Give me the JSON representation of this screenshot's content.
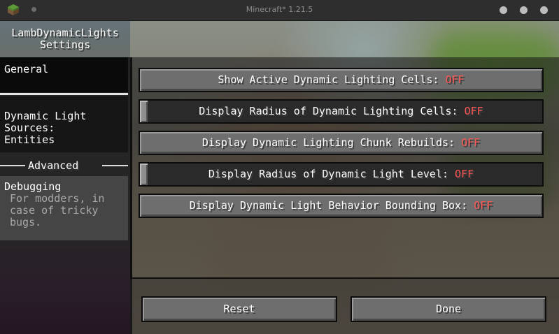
{
  "window": {
    "title": "Minecraft* 1.21.5"
  },
  "sidebar": {
    "title_line1": "LambDynamicLights",
    "title_line2": "Settings",
    "items": [
      {
        "label": "General"
      },
      {
        "label_lines": [
          "Dynamic Light",
          "Sources:",
          "Entities"
        ]
      }
    ],
    "advanced_header": "Advanced",
    "debugging": {
      "label": "Debugging",
      "description_lines": [
        "For modders, in",
        "case of tricky",
        "bugs."
      ]
    }
  },
  "options": [
    {
      "label": "Show Active Dynamic Lighting Cells: ",
      "value": "OFF",
      "kind": "button"
    },
    {
      "label": "Display Radius of Dynamic Lighting Cells: ",
      "value": "OFF",
      "kind": "slider",
      "slider_level": 0
    },
    {
      "label": "Display Dynamic Lighting Chunk Rebuilds: ",
      "value": "OFF",
      "kind": "button"
    },
    {
      "label": "Display Radius of Dynamic Light Level: ",
      "value": "OFF",
      "kind": "slider",
      "slider_level": 0
    },
    {
      "label": "Display Dynamic Light Behavior Bounding Box: ",
      "value": "OFF",
      "kind": "button"
    }
  ],
  "footer": {
    "reset_label": "Reset",
    "done_label": "Done"
  },
  "colors": {
    "off_value": "#ff5555"
  }
}
